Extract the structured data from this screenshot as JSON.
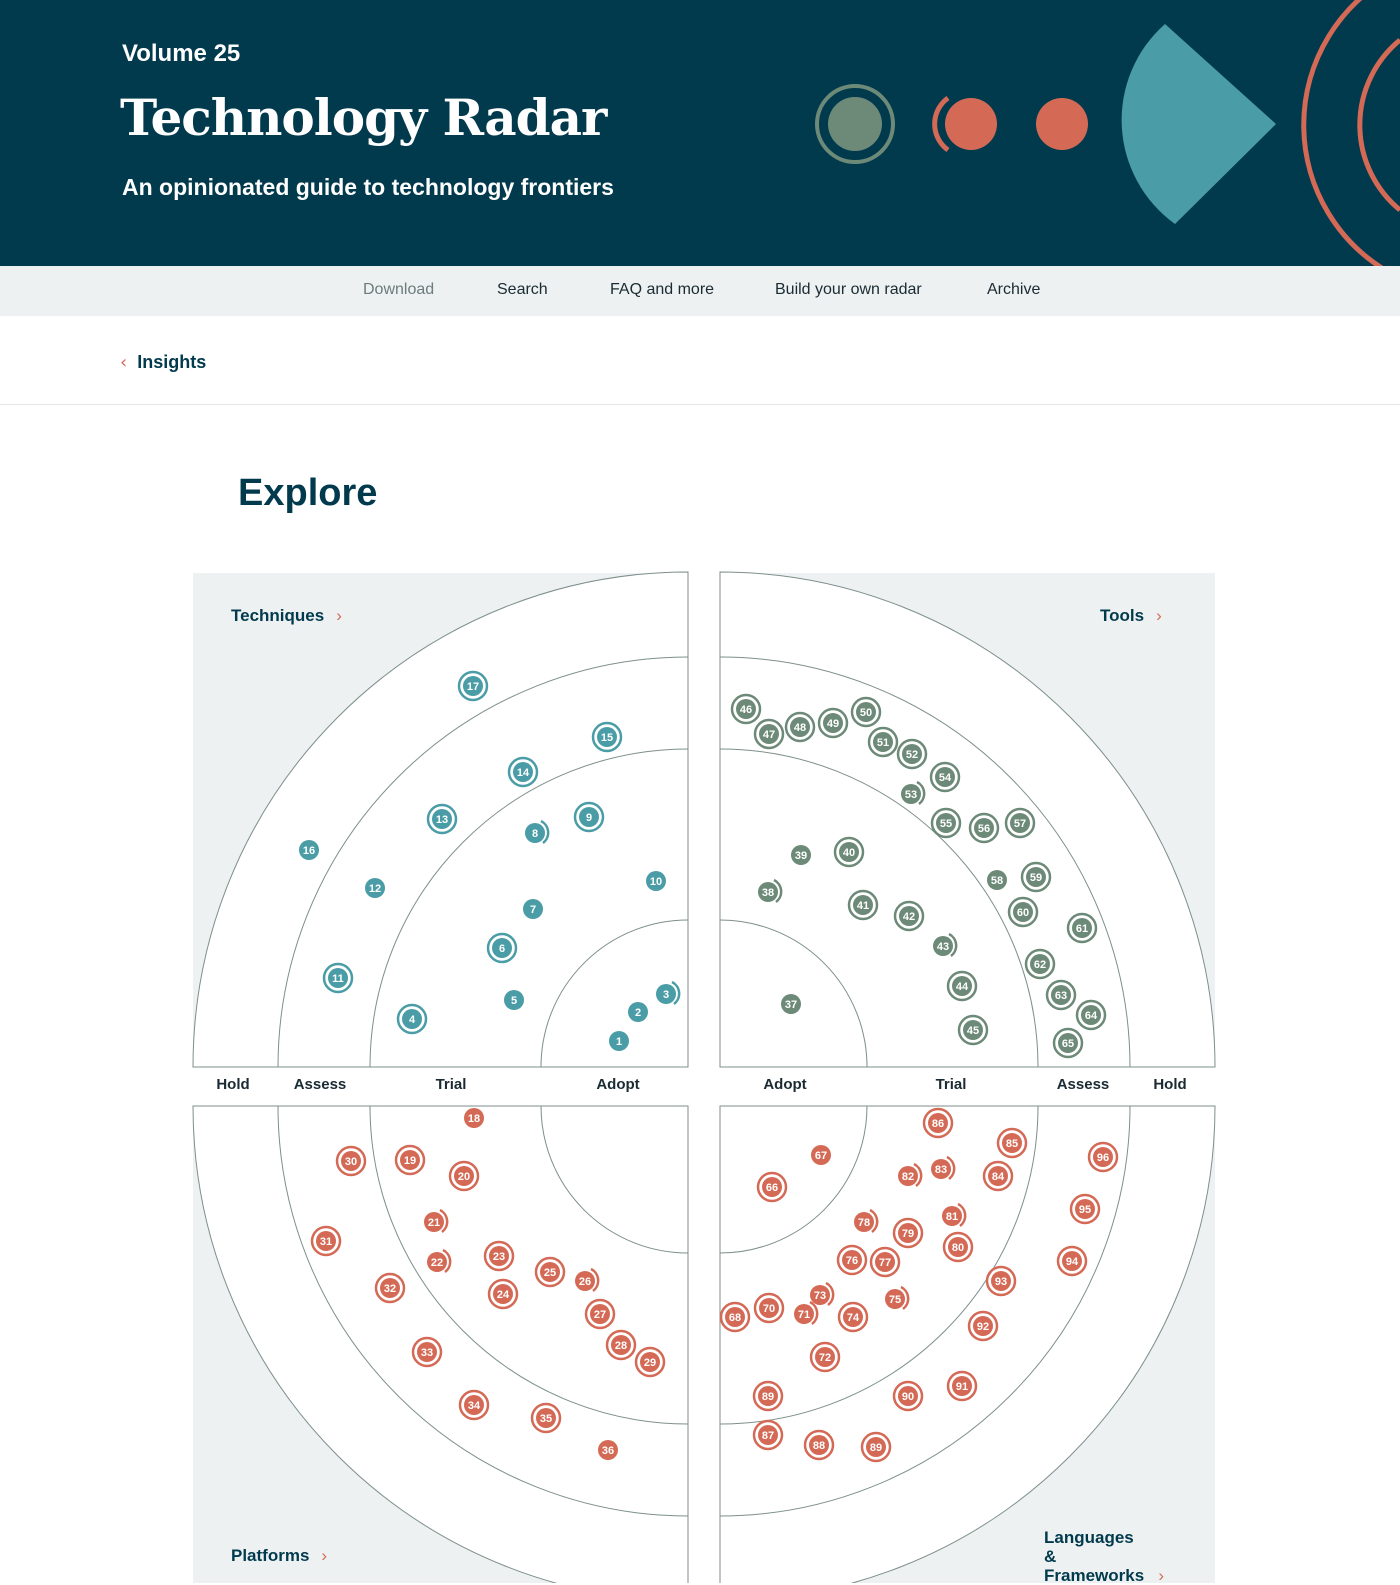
{
  "header": {
    "volume": "Volume 25",
    "title": "Technology Radar",
    "subtitle": "An opinionated guide to technology frontiers"
  },
  "nav": [
    "Download",
    "Search",
    "FAQ and more",
    "Build your own radar",
    "Archive"
  ],
  "breadcrumb": {
    "label": "Insights",
    "icon": "chevron-left-icon"
  },
  "section_title": "Explore",
  "colors": {
    "navy": "#023a4d",
    "techniques": "#4a9da6",
    "tools": "#6d8a78",
    "platforms": "#d46a56",
    "languages": "#d46a56",
    "quadrant_bg": "#edf1f1",
    "ring_line": "#7d8f8c"
  },
  "quadrants": {
    "techniques": "Techniques",
    "tools": "Tools",
    "platforms": "Platforms",
    "languages": "Languages & Frameworks"
  },
  "rings": {
    "left": [
      "Hold",
      "Assess",
      "Trial",
      "Adopt"
    ],
    "right": [
      "Adopt",
      "Trial",
      "Assess",
      "Hold"
    ]
  },
  "blips": [
    {
      "n": "1",
      "q": "techniques",
      "r": "Adopt",
      "style": "plain"
    },
    {
      "n": "2",
      "q": "techniques",
      "r": "Adopt",
      "style": "plain"
    },
    {
      "n": "3",
      "q": "techniques",
      "r": "Adopt",
      "style": "moved"
    },
    {
      "n": "4",
      "q": "techniques",
      "r": "Trial",
      "style": "new"
    },
    {
      "n": "5",
      "q": "techniques",
      "r": "Trial",
      "style": "plain"
    },
    {
      "n": "6",
      "q": "techniques",
      "r": "Trial",
      "style": "new"
    },
    {
      "n": "7",
      "q": "techniques",
      "r": "Trial",
      "style": "plain"
    },
    {
      "n": "8",
      "q": "techniques",
      "r": "Trial",
      "style": "moved"
    },
    {
      "n": "9",
      "q": "techniques",
      "r": "Trial",
      "style": "new"
    },
    {
      "n": "10",
      "q": "techniques",
      "r": "Trial",
      "style": "plain"
    },
    {
      "n": "11",
      "q": "techniques",
      "r": "Assess",
      "style": "new"
    },
    {
      "n": "12",
      "q": "techniques",
      "r": "Assess",
      "style": "plain"
    },
    {
      "n": "13",
      "q": "techniques",
      "r": "Assess",
      "style": "new"
    },
    {
      "n": "14",
      "q": "techniques",
      "r": "Assess",
      "style": "new"
    },
    {
      "n": "15",
      "q": "techniques",
      "r": "Assess",
      "style": "new"
    },
    {
      "n": "16",
      "q": "techniques",
      "r": "Hold",
      "style": "plain"
    },
    {
      "n": "17",
      "q": "techniques",
      "r": "Hold",
      "style": "new"
    },
    {
      "n": "37",
      "q": "tools",
      "r": "Adopt",
      "style": "plain"
    },
    {
      "n": "38",
      "q": "tools",
      "r": "Trial",
      "style": "moved"
    },
    {
      "n": "39",
      "q": "tools",
      "r": "Trial",
      "style": "plain"
    },
    {
      "n": "40",
      "q": "tools",
      "r": "Trial",
      "style": "new"
    },
    {
      "n": "41",
      "q": "tools",
      "r": "Trial",
      "style": "new"
    },
    {
      "n": "42",
      "q": "tools",
      "r": "Trial",
      "style": "new"
    },
    {
      "n": "43",
      "q": "tools",
      "r": "Trial",
      "style": "moved"
    },
    {
      "n": "44",
      "q": "tools",
      "r": "Trial",
      "style": "new"
    },
    {
      "n": "45",
      "q": "tools",
      "r": "Trial",
      "style": "new"
    },
    {
      "n": "46",
      "q": "tools",
      "r": "Assess",
      "style": "new"
    },
    {
      "n": "47",
      "q": "tools",
      "r": "Assess",
      "style": "new"
    },
    {
      "n": "48",
      "q": "tools",
      "r": "Assess",
      "style": "new"
    },
    {
      "n": "49",
      "q": "tools",
      "r": "Assess",
      "style": "new"
    },
    {
      "n": "50",
      "q": "tools",
      "r": "Assess",
      "style": "new"
    },
    {
      "n": "51",
      "q": "tools",
      "r": "Assess",
      "style": "new"
    },
    {
      "n": "52",
      "q": "tools",
      "r": "Assess",
      "style": "new"
    },
    {
      "n": "53",
      "q": "tools",
      "r": "Assess",
      "style": "moved"
    },
    {
      "n": "54",
      "q": "tools",
      "r": "Assess",
      "style": "new"
    },
    {
      "n": "55",
      "q": "tools",
      "r": "Assess",
      "style": "new"
    },
    {
      "n": "56",
      "q": "tools",
      "r": "Assess",
      "style": "new"
    },
    {
      "n": "57",
      "q": "tools",
      "r": "Assess",
      "style": "new"
    },
    {
      "n": "58",
      "q": "tools",
      "r": "Assess",
      "style": "plain"
    },
    {
      "n": "59",
      "q": "tools",
      "r": "Assess",
      "style": "new"
    },
    {
      "n": "60",
      "q": "tools",
      "r": "Assess",
      "style": "new"
    },
    {
      "n": "61",
      "q": "tools",
      "r": "Assess",
      "style": "new"
    },
    {
      "n": "62",
      "q": "tools",
      "r": "Assess",
      "style": "new"
    },
    {
      "n": "63",
      "q": "tools",
      "r": "Assess",
      "style": "new"
    },
    {
      "n": "64",
      "q": "tools",
      "r": "Assess",
      "style": "new"
    },
    {
      "n": "65",
      "q": "tools",
      "r": "Assess",
      "style": "new"
    },
    {
      "n": "18",
      "q": "platforms",
      "r": "Trial",
      "style": "plain"
    },
    {
      "n": "19",
      "q": "platforms",
      "r": "Trial",
      "style": "new"
    },
    {
      "n": "20",
      "q": "platforms",
      "r": "Trial",
      "style": "new"
    },
    {
      "n": "21",
      "q": "platforms",
      "r": "Trial",
      "style": "moved"
    },
    {
      "n": "22",
      "q": "platforms",
      "r": "Trial",
      "style": "moved"
    },
    {
      "n": "23",
      "q": "platforms",
      "r": "Trial",
      "style": "new"
    },
    {
      "n": "24",
      "q": "platforms",
      "r": "Trial",
      "style": "new"
    },
    {
      "n": "25",
      "q": "platforms",
      "r": "Trial",
      "style": "new"
    },
    {
      "n": "26",
      "q": "platforms",
      "r": "Trial",
      "style": "moved"
    },
    {
      "n": "27",
      "q": "platforms",
      "r": "Trial",
      "style": "new"
    },
    {
      "n": "28",
      "q": "platforms",
      "r": "Trial",
      "style": "new"
    },
    {
      "n": "29",
      "q": "platforms",
      "r": "Trial",
      "style": "new"
    },
    {
      "n": "30",
      "q": "platforms",
      "r": "Assess",
      "style": "new"
    },
    {
      "n": "31",
      "q": "platforms",
      "r": "Assess",
      "style": "new"
    },
    {
      "n": "32",
      "q": "platforms",
      "r": "Assess",
      "style": "new"
    },
    {
      "n": "33",
      "q": "platforms",
      "r": "Assess",
      "style": "new"
    },
    {
      "n": "34",
      "q": "platforms",
      "r": "Assess",
      "style": "new"
    },
    {
      "n": "35",
      "q": "platforms",
      "r": "Assess",
      "style": "new"
    },
    {
      "n": "36",
      "q": "platforms",
      "r": "Assess",
      "style": "plain"
    },
    {
      "n": "66",
      "q": "languages",
      "r": "Adopt",
      "style": "new"
    },
    {
      "n": "67",
      "q": "languages",
      "r": "Adopt",
      "style": "plain"
    },
    {
      "n": "68",
      "q": "languages",
      "r": "Trial",
      "style": "new"
    },
    {
      "n": "70",
      "q": "languages",
      "r": "Trial",
      "style": "new"
    },
    {
      "n": "71",
      "q": "languages",
      "r": "Trial",
      "style": "moved"
    },
    {
      "n": "72",
      "q": "languages",
      "r": "Trial",
      "style": "new"
    },
    {
      "n": "73",
      "q": "languages",
      "r": "Trial",
      "style": "moved"
    },
    {
      "n": "74",
      "q": "languages",
      "r": "Trial",
      "style": "new"
    },
    {
      "n": "75",
      "q": "languages",
      "r": "Trial",
      "style": "moved"
    },
    {
      "n": "76",
      "q": "languages",
      "r": "Trial",
      "style": "new"
    },
    {
      "n": "77",
      "q": "languages",
      "r": "Trial",
      "style": "new"
    },
    {
      "n": "78",
      "q": "languages",
      "r": "Trial",
      "style": "moved"
    },
    {
      "n": "79",
      "q": "languages",
      "r": "Trial",
      "style": "new"
    },
    {
      "n": "80",
      "q": "languages",
      "r": "Trial",
      "style": "new"
    },
    {
      "n": "81",
      "q": "languages",
      "r": "Trial",
      "style": "moved"
    },
    {
      "n": "82",
      "q": "languages",
      "r": "Trial",
      "style": "moved"
    },
    {
      "n": "83",
      "q": "languages",
      "r": "Trial",
      "style": "moved"
    },
    {
      "n": "84",
      "q": "languages",
      "r": "Assess",
      "style": "new"
    },
    {
      "n": "85",
      "q": "languages",
      "r": "Assess",
      "style": "new"
    },
    {
      "n": "86",
      "q": "languages",
      "r": "Assess",
      "style": "new"
    },
    {
      "n": "89",
      "q": "languages",
      "r": "Assess",
      "style": "new"
    },
    {
      "n": "87",
      "q": "languages",
      "r": "Assess",
      "style": "new"
    },
    {
      "n": "88",
      "q": "languages",
      "r": "Assess",
      "style": "new"
    },
    {
      "n": "89",
      "q": "languages",
      "r": "Assess",
      "style": "new"
    },
    {
      "n": "90",
      "q": "languages",
      "r": "Assess",
      "style": "new"
    },
    {
      "n": "91",
      "q": "languages",
      "r": "Assess",
      "style": "new"
    },
    {
      "n": "92",
      "q": "languages",
      "r": "Assess",
      "style": "new"
    },
    {
      "n": "93",
      "q": "languages",
      "r": "Assess",
      "style": "new"
    },
    {
      "n": "94",
      "q": "languages",
      "r": "Hold",
      "style": "new"
    },
    {
      "n": "95",
      "q": "languages",
      "r": "Hold",
      "style": "new"
    },
    {
      "n": "96",
      "q": "languages",
      "r": "Hold",
      "style": "new"
    }
  ]
}
